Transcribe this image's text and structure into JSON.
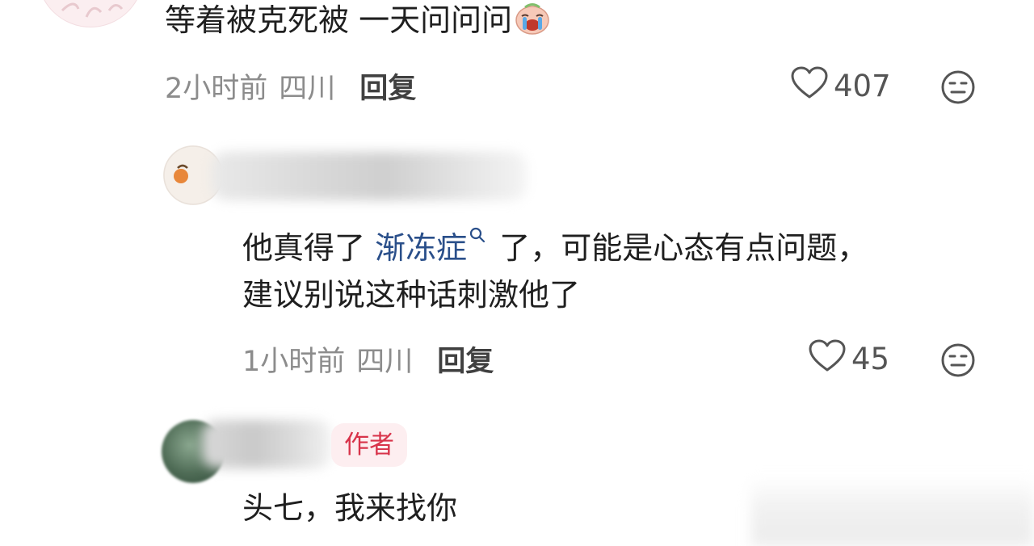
{
  "comments": [
    {
      "text": "等着被克死被 一天问问问",
      "emoji": "crying-face-emoji",
      "time": "2小时前",
      "location": "四川",
      "reply_label": "回复",
      "likes": "407"
    }
  ],
  "replies": [
    {
      "text_before": "他真得了 ",
      "link_term": "渐冻症",
      "text_after_line1": " 了，可能是心态有点问题，",
      "text_line2": "建议别说这种话刺激他了",
      "time": "1小时前",
      "location": "四川",
      "reply_label": "回复",
      "likes": "45"
    },
    {
      "author_badge": "作者",
      "text": "头七，我来找你"
    }
  ],
  "icons": {
    "like": "heart-outline-icon",
    "dislike": "neutral-face-icon",
    "search": "search-icon"
  },
  "colors": {
    "link": "#2a4f8a",
    "badge_text": "#d8334a",
    "badge_bg": "#fdeef0",
    "meta": "#8c8c8c"
  }
}
